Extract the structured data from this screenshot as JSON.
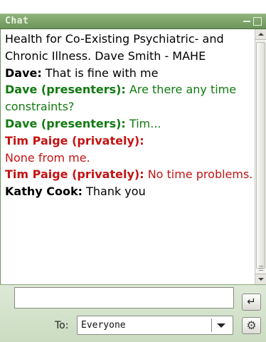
{
  "window": {
    "title": "Chat"
  },
  "messages": [
    {
      "sender": "",
      "text": "Health for Co-Existing Psychiatric- and Chronic Illness.  Dave Smith - MAHE",
      "color": "black"
    },
    {
      "sender": "Dave:",
      "text": "That is fine with me",
      "color": "black"
    },
    {
      "sender": "Dave (presenters):",
      "text": "Are there any time constraints?",
      "color": "green"
    },
    {
      "sender": "Dave (presenters):",
      "text": "Tim...",
      "color": "green"
    },
    {
      "sender": "Tim Paige  (privately):",
      "text": "None from me.",
      "color": "red"
    },
    {
      "sender": "Tim Paige  (privately):",
      "text": "No time problems.",
      "color": "red"
    },
    {
      "sender": "Kathy Cook:",
      "text": "Thank you",
      "color": "black"
    }
  ],
  "input": {
    "value": ""
  },
  "send": {
    "icon": "enter-icon",
    "glyph": "↵"
  },
  "recipient": {
    "label": "To:",
    "value": "Everyone"
  },
  "settings": {
    "icon": "gear-icon",
    "glyph": "⚙"
  },
  "colors": {
    "black": "#000000",
    "green": "#117a11",
    "red": "#c41313",
    "title_bar": "#7ea56a"
  }
}
